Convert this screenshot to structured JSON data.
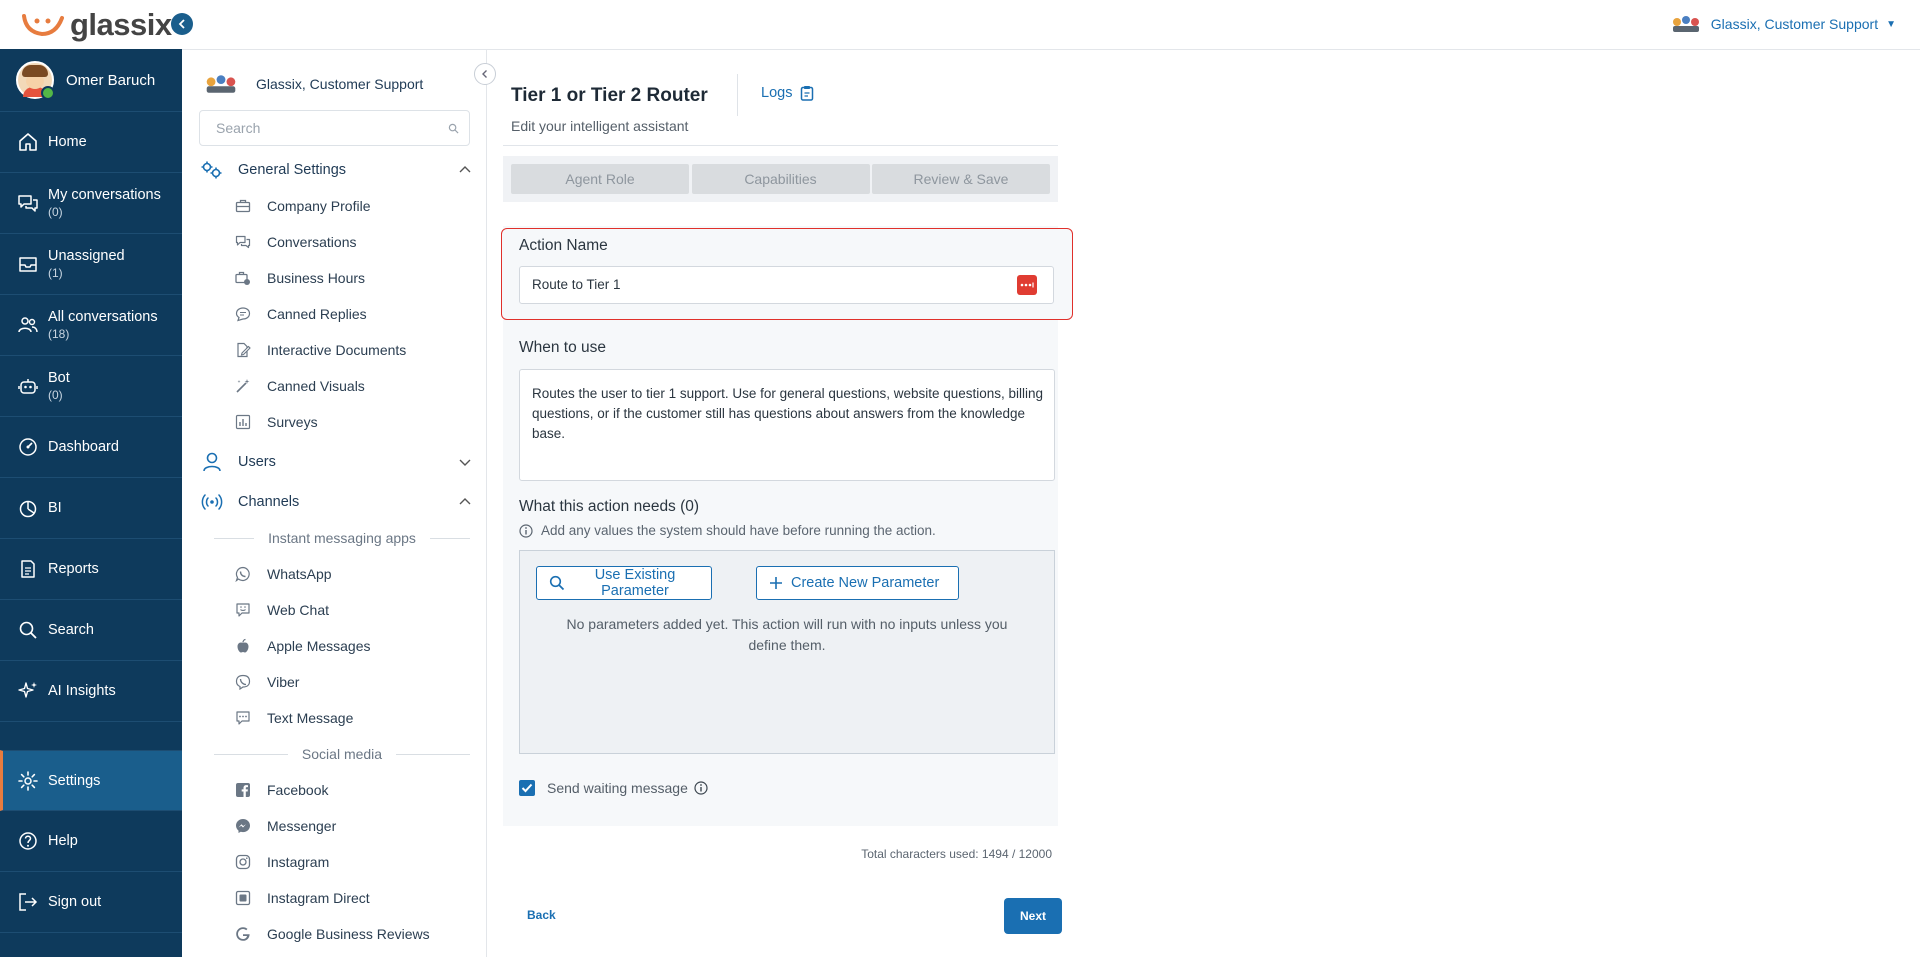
{
  "app": {
    "logo_text": "glassix",
    "org_name": "Glassix, Customer Support"
  },
  "user": {
    "name": "Omer Baruch"
  },
  "nav": [
    {
      "label": "Home",
      "count": "",
      "icon": "home-icon"
    },
    {
      "label": "My conversations",
      "count": "(0)",
      "icon": "chat-bubbles-icon"
    },
    {
      "label": "Unassigned",
      "count": "(1)",
      "icon": "inbox-icon"
    },
    {
      "label": "All conversations",
      "count": "(18)",
      "icon": "people-icon"
    },
    {
      "label": "Bot",
      "count": "(0)",
      "icon": "robot-icon"
    },
    {
      "label": "Dashboard",
      "count": "",
      "icon": "gauge-icon"
    },
    {
      "label": "BI",
      "count": "",
      "icon": "pie-chart-icon"
    },
    {
      "label": "Reports",
      "count": "",
      "icon": "report-icon"
    },
    {
      "label": "Search",
      "count": "",
      "icon": "search-icon"
    },
    {
      "label": "AI Insights",
      "count": "",
      "icon": "sparkles-icon"
    },
    {
      "label": "Settings",
      "count": "",
      "icon": "gear-icon"
    },
    {
      "label": "Help",
      "count": "",
      "icon": "help-icon"
    },
    {
      "label": "Sign out",
      "count": "",
      "icon": "sign-out-icon"
    }
  ],
  "sidebar": {
    "org_name": "Glassix, Customer Support",
    "search_placeholder": "Search",
    "sections": {
      "general": "General Settings",
      "users": "Users",
      "channels": "Channels"
    },
    "general_items": [
      "Company Profile",
      "Conversations",
      "Business Hours",
      "Canned Replies",
      "Interactive Documents",
      "Canned Visuals",
      "Surveys"
    ],
    "dividers": {
      "im": "Instant messaging apps",
      "social": "Social media"
    },
    "im_items": [
      "WhatsApp",
      "Web Chat",
      "Apple Messages",
      "Viber",
      "Text Message"
    ],
    "social_items": [
      "Facebook",
      "Messenger",
      "Instagram",
      "Instagram Direct",
      "Google Business Reviews"
    ]
  },
  "main": {
    "title": "Tier 1 or Tier 2 Router",
    "logs_label": "Logs",
    "subtitle": "Edit your intelligent assistant",
    "steps": [
      "Agent Role",
      "Capabilities",
      "Review & Save"
    ],
    "action_name_label": "Action Name",
    "action_name_value": "Route to Tier 1",
    "when_label": "When to use",
    "when_value": "Routes the user to tier 1 support. Use for general questions, website questions, billing questions, or if the customer still has questions about answers from the knowledge base.",
    "needs_label": "What this action needs (0)",
    "needs_hint": "Add any values the system should have before running the action.",
    "use_existing_label": "Use Existing Parameter",
    "create_new_label": "Create New Parameter",
    "params_empty": "No parameters added yet. This action will run with no inputs unless you define them.",
    "send_waiting_label": "Send waiting message",
    "send_waiting_checked": true,
    "char_count": "Total characters used: 1494 / 12000",
    "back_label": "Back",
    "next_label": "Next"
  },
  "colors": {
    "nav_bg": "#0e3a5c",
    "nav_active": "#1a5e8c",
    "accent": "#1a6fb2",
    "highlight_border": "#e0302b",
    "brand_orange": "#e77c3f"
  }
}
